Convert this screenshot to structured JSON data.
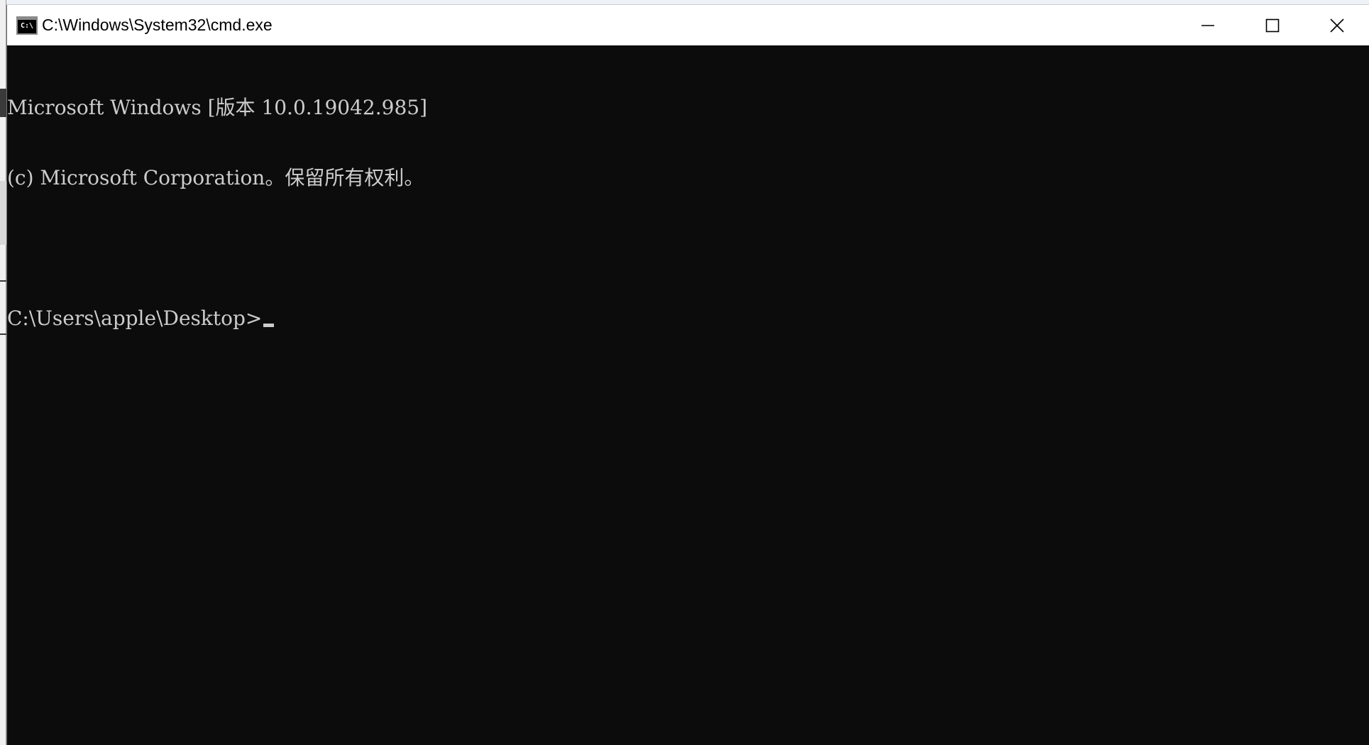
{
  "window": {
    "title": "C:\\Windows\\System32\\cmd.exe",
    "icon": "cmd-icon",
    "icon_glyph": "C:\\",
    "controls": {
      "minimize": "minimize-icon",
      "maximize": "maximize-icon",
      "close": "close-icon"
    }
  },
  "terminal": {
    "lines": [
      "Microsoft Windows [版本 10.0.19042.985]",
      "(c) Microsoft Corporation。保留所有权利。",
      "",
      "C:\\Users\\apple\\Desktop>"
    ],
    "background": "#0c0c0c",
    "foreground": "#cccccc"
  }
}
